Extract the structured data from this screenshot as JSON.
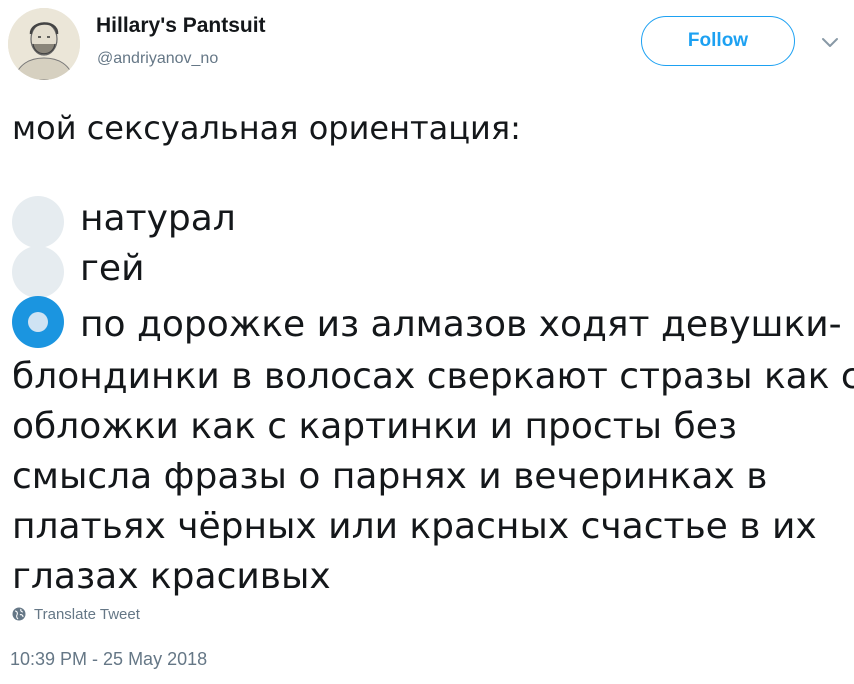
{
  "user": {
    "display_name": "Hillary's Pantsuit",
    "handle": "@andriyanov_no"
  },
  "follow_label": "Follow",
  "tweet": {
    "intro": "мой сексуальная ориентация:",
    "options": [
      {
        "label": "натурал",
        "selected": false
      },
      {
        "label": "гей",
        "selected": false
      },
      {
        "label": "по дорожке из алмазов ходят девушки-",
        "selected": true
      }
    ],
    "continuation": [
      "блондинки в волосах сверкают стразы как с",
      "обложки как с картинки и просты без",
      "смысла фразы о парнях и вечеринках в",
      "платьях чёрных или красных счастье в их",
      "глазах красивых"
    ]
  },
  "translate_label": "Translate Tweet",
  "timestamp": "10:39 PM - 25 May 2018",
  "colors": {
    "accent": "#1da1f2",
    "selected_dot": "#1b95e0",
    "unselected_dot": "#e6ecf0",
    "muted_text": "#657786"
  }
}
